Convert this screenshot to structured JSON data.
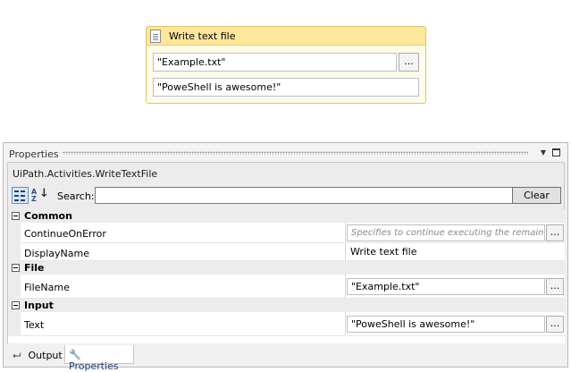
{
  "activity": {
    "title": "Write text file",
    "filename_value": "\"Example.txt\"",
    "text_value": "\"PoweShell is awesome!\"",
    "browse_label": "..."
  },
  "properties_panel": {
    "title": "Properties",
    "pin_glyph": "▼",
    "class_name": "UiPath.Activities.WriteTextFile",
    "search_label": "Search:",
    "search_value": "",
    "clear_label": "Clear",
    "alpha_label_top": "A",
    "alpha_label_bottom": "Z",
    "categories": [
      {
        "name": "Common",
        "properties": [
          {
            "name": "ContinueOnError",
            "value": "Specifies to continue executing the remaining activities even if the current activity has failed."
          },
          {
            "name": "DisplayName",
            "value": "Write text file"
          }
        ]
      },
      {
        "name": "File",
        "properties": [
          {
            "name": "FileName",
            "value": "\"Example.txt\""
          }
        ]
      },
      {
        "name": "Input",
        "properties": [
          {
            "name": "Text",
            "value": "\"PoweShell is awesome!\""
          }
        ]
      }
    ],
    "browse_label": "..."
  },
  "tabs": [
    {
      "label": "Output",
      "icon": "arrow-icon"
    },
    {
      "label": "Properties",
      "icon": "wrench-icon"
    }
  ],
  "colors": {
    "activity_header": "#fce79a",
    "activity_border": "#e3c264",
    "panel_background": "#f0f0f0"
  }
}
